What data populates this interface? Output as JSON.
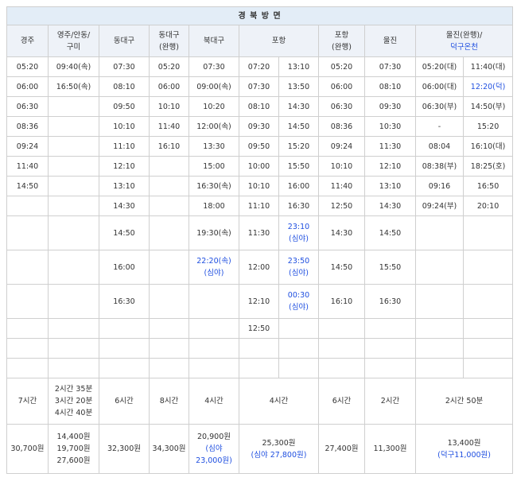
{
  "title": "경 북 방 면",
  "headers": {
    "gyeongju": "경주",
    "yeongju_line1": "영주/안동/",
    "yeongju_line2": "구미",
    "dongdaegu": "동대구",
    "dongdaegu_express_line1": "동대구",
    "dongdaegu_express_line2": "(완행)",
    "bukdaegu": "북대구",
    "pohang": "포항",
    "pohang_local_line1": "포항",
    "pohang_local_line2": "(완행)",
    "uljin": "울진",
    "uljin_local_line1": "울진(완행)/",
    "uljin_local_line2": "덕구온천"
  },
  "times": {
    "r1": {
      "c1": "05:20",
      "c2": "09:40(속)",
      "c3": "07:30",
      "c4": "05:20",
      "c5": "07:30",
      "c6": "07:20",
      "c7": "13:10",
      "c8": "05:20",
      "c9": "07:30",
      "c10": "05:20(대)",
      "c11": "11:40(대)"
    },
    "r2": {
      "c1": "06:00",
      "c2": "16:50(속)",
      "c3": "08:10",
      "c4": "06:00",
      "c5": "09:00(속)",
      "c6": "07:30",
      "c7": "13:50",
      "c8": "06:00",
      "c9": "08:10",
      "c10": "06:00(대)",
      "c11": "12:20(덕)"
    },
    "r3": {
      "c1": "06:30",
      "c3": "09:50",
      "c4": "10:10",
      "c5": "10:20",
      "c6": "08:10",
      "c7": "14:30",
      "c8": "06:30",
      "c9": "09:30",
      "c10": "06:30(부)",
      "c11": "14:50(부)"
    },
    "r4": {
      "c1": "08:36",
      "c3": "10:10",
      "c4": "11:40",
      "c5": "12:00(속)",
      "c6": "09:30",
      "c7": "14:50",
      "c8": "08:36",
      "c9": "10:30",
      "c10": "-",
      "c11": "15:20"
    },
    "r5": {
      "c1": "09:24",
      "c3": "11:10",
      "c4": "16:10",
      "c5": "13:30",
      "c6": "09:50",
      "c7": "15:20",
      "c8": "09:24",
      "c9": "11:30",
      "c10": "08:04",
      "c11": "16:10(대)"
    },
    "r6": {
      "c1": "11:40",
      "c3": "12:10",
      "c5": "15:00",
      "c6": "10:00",
      "c7": "15:50",
      "c8": "10:10",
      "c9": "12:10",
      "c10": "08:38(부)",
      "c11": "18:25(호)"
    },
    "r7": {
      "c1": "14:50",
      "c3": "13:10",
      "c5": "16:30(속)",
      "c6": "10:10",
      "c7": "16:00",
      "c8": "11:40",
      "c9": "13:10",
      "c10": "09:16",
      "c11": "16:50"
    },
    "r8": {
      "c3": "14:30",
      "c5": "18:00",
      "c6": "11:10",
      "c7": "16:30",
      "c8": "12:50",
      "c9": "14:30",
      "c10": "09:24(부)",
      "c11": "20:10"
    },
    "r9": {
      "c3": "14:50",
      "c5": "19:30(속)",
      "c6": "11:30",
      "c7_l1": "23:10",
      "c7_l2": "(심야)",
      "c8": "14:30",
      "c9": "14:50"
    },
    "r10": {
      "c3": "16:00",
      "c5_l1": "22:20(속)",
      "c5_l2": "(심야)",
      "c6": "12:00",
      "c7_l1": "23:50",
      "c7_l2": "(심야)",
      "c8": "14:50",
      "c9": "15:50"
    },
    "r11": {
      "c3": "16:30",
      "c6": "12:10",
      "c7_l1": "00:30",
      "c7_l2": "(심야)",
      "c8": "16:10",
      "c9": "16:30"
    },
    "r12": {
      "c6": "12:50"
    }
  },
  "durations": {
    "gyeongju": "7시간",
    "yeongju": "2시간 35분\n3시간 20분\n4시간 40분",
    "dongdaegu": "6시간",
    "dongdaegu_express": "8시간",
    "bukdaegu": "4시간",
    "pohang": "4시간",
    "pohang_local": "6시간",
    "uljin": "2시간",
    "uljin_local": "2시간 50분"
  },
  "fares": {
    "gyeongju": "30,700원",
    "yeongju": "14,400원\n19,700원\n27,600원",
    "dongdaegu": "32,300원",
    "dongdaegu_express": "34,300원",
    "bukdaegu_main": "20,900원",
    "bukdaegu_night": "(심야\n23,000원)",
    "pohang_main": "25,300원",
    "pohang_night": "(심야 27,800원)",
    "pohang_local": "27,400원",
    "uljin": "11,300원",
    "uljin_local_main": "13,400원",
    "uljin_local_deokgu": "(덕구11,000원)"
  },
  "colors": {
    "header_bg": "#e3edf7",
    "border": "#cfcfcf",
    "night_blue": "#1f4fe0"
  }
}
